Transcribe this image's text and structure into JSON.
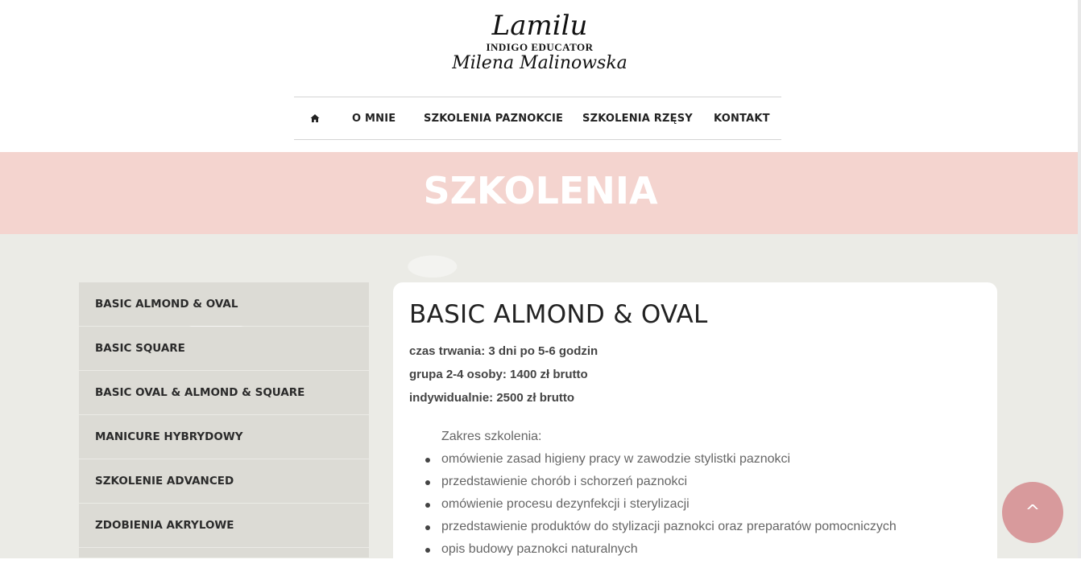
{
  "logo": {
    "line1": "Lamilu",
    "line2": "INDIGO EDUCATOR",
    "line3": "Milena Malinowska"
  },
  "nav": {
    "home_icon": "home-icon",
    "items": [
      "O MNIE",
      "SZKOLENIA PAZNOKCIE",
      "SZKOLENIA RZĘSY",
      "KONTAKT"
    ]
  },
  "banner": {
    "title": "SZKOLENIA",
    "background": "#f4d4cf"
  },
  "sidebar": {
    "items": [
      "BASIC ALMOND & OVAL",
      "BASIC SQUARE",
      "BASIC OVAL & ALMOND & SQUARE",
      "MANICURE HYBRYDOWY",
      "SZKOLENIE ADVANCED",
      "ZDOBIENIA AKRYLOWE"
    ]
  },
  "course": {
    "title": "BASIC ALMOND & OVAL",
    "duration": "czas trwania: 3 dni po 5-6 godzin",
    "group_price": "grupa 2-4 osoby: 1400 zł brutto",
    "individual_price": "indywidualnie: 2500 zł brutto",
    "scope_label": "Zakres szkolenia:",
    "scope_items": [
      "omówienie zasad higieny pracy w zawodzie stylistki paznokci",
      "przedstawienie chorób i schorzeń paznokci",
      "omówienie procesu dezynfekcji i sterylizacji",
      "przedstawienie produktów do stylizacji paznokci oraz preparatów pomocniczych",
      "opis budowy paznokci naturalnych"
    ]
  },
  "scroll_top": {
    "label": "^",
    "color": "#d89a9c"
  }
}
